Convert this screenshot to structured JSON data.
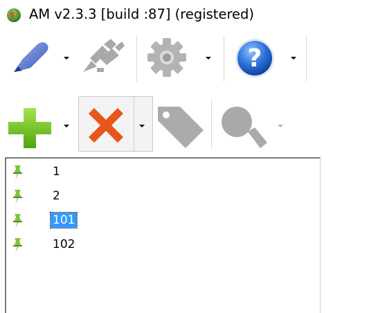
{
  "window": {
    "title": "AM v2.3.3 [build :87] (registered)"
  },
  "toolbar_top": {
    "buttons": [
      {
        "icon": "connect-icon",
        "has_dropdown": true,
        "enabled": true
      },
      {
        "icon": "disconnect-icon",
        "has_dropdown": false,
        "enabled": false
      },
      {
        "icon": "gear-icon",
        "has_dropdown": true,
        "enabled": false
      },
      {
        "icon": "help-icon",
        "has_dropdown": true,
        "enabled": true
      }
    ]
  },
  "toolbar_bottom": {
    "buttons": [
      {
        "icon": "add-icon",
        "has_dropdown": true,
        "enabled": true
      },
      {
        "icon": "delete-icon",
        "has_dropdown": true,
        "enabled": true,
        "pressed": true
      },
      {
        "icon": "tag-icon",
        "has_dropdown": false,
        "enabled": false
      },
      {
        "icon": "search-icon",
        "has_dropdown": true,
        "enabled": false
      }
    ]
  },
  "colors": {
    "selection": "#3399ff",
    "add": "#6ec11e",
    "delete": "#e8561b",
    "help": "#2a6fd6"
  },
  "tree": {
    "items": [
      {
        "label": "1",
        "selected": false
      },
      {
        "label": "2",
        "selected": false
      },
      {
        "label": "101",
        "selected": true
      },
      {
        "label": "102",
        "selected": false
      }
    ]
  }
}
